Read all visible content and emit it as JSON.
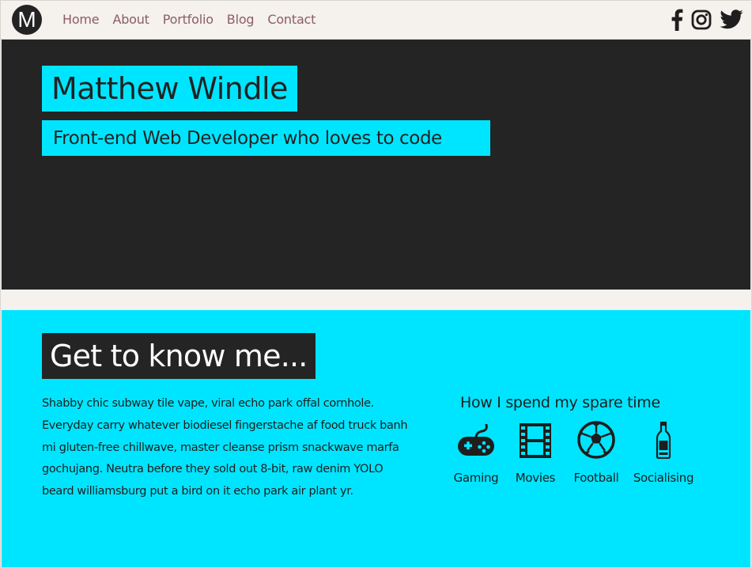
{
  "nav": {
    "logo": "M",
    "links": [
      "Home",
      "About",
      "Portfolio",
      "Blog",
      "Contact"
    ],
    "social": [
      "facebook-icon",
      "instagram-icon",
      "twitter-icon"
    ]
  },
  "hero": {
    "name": "Matthew Windle",
    "tagline": "Front-end Web Developer who loves to code"
  },
  "about": {
    "title": "Get to know me...",
    "bio": "Shabby chic subway tile vape, viral echo park offal cornhole. Everyday carry whatever biodiesel fingerstache af food truck banh mi gluten-free chillwave, master cleanse prism snackwave marfa gochujang.  Neutra before they sold out 8-bit, raw denim YOLO beard williamsburg put a bird on it echo park air plant yr.",
    "spare_title": "How I spend my spare time",
    "hobbies": [
      {
        "label": "Gaming",
        "icon": "gamepad-icon"
      },
      {
        "label": "Movies",
        "icon": "film-icon"
      },
      {
        "label": "Football",
        "icon": "football-icon"
      },
      {
        "label": "Socialising",
        "icon": "bottle-icon"
      }
    ]
  },
  "colors": {
    "accent": "#00e5ff",
    "dark": "#242424",
    "nav_link": "#8b5c68",
    "background": "#f5f1ed"
  }
}
